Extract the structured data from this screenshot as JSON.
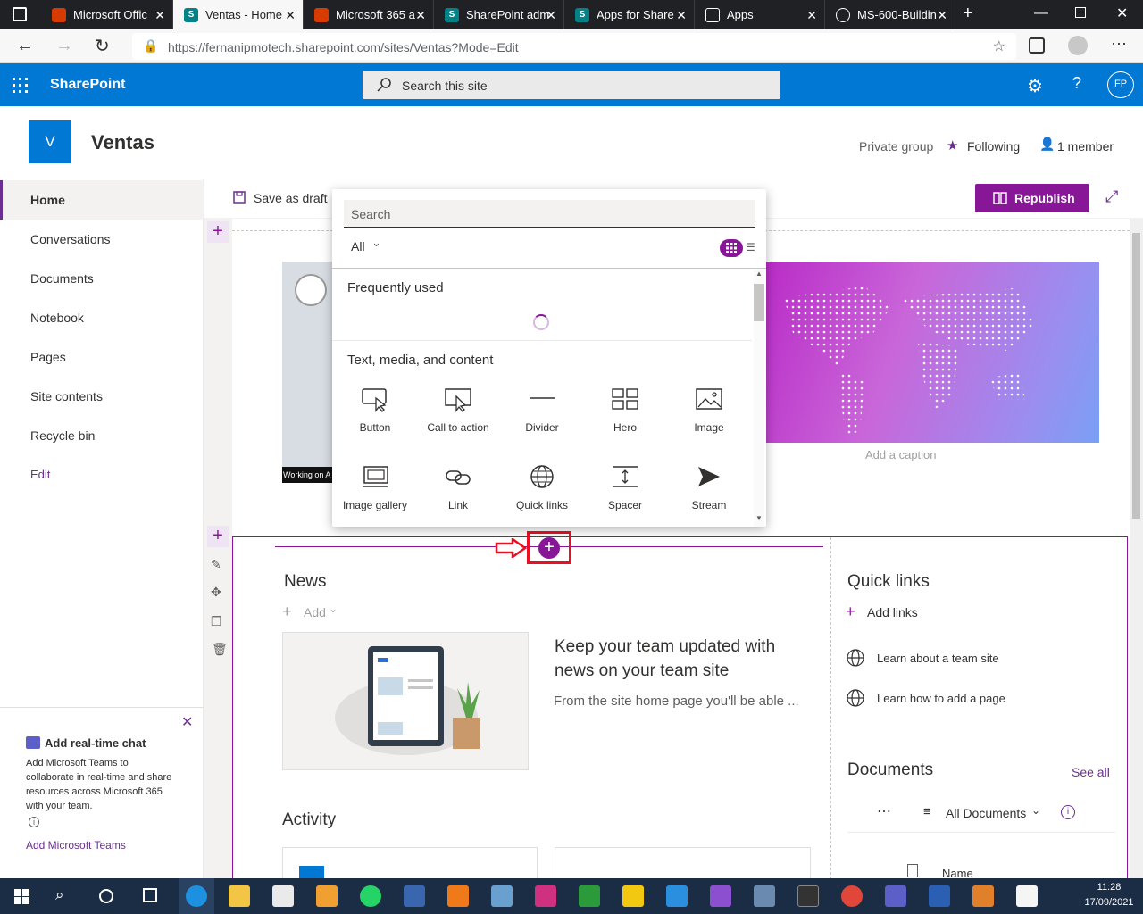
{
  "browser": {
    "tabs": [
      {
        "title": "Microsoft Offic",
        "active": false,
        "favicon_color": "#d83b01"
      },
      {
        "title": "Ventas - Home",
        "active": true,
        "favicon_color": "#038387"
      },
      {
        "title": "Microsoft 365 a",
        "active": false,
        "favicon_color": "#d83b01"
      },
      {
        "title": "SharePoint adm",
        "active": false,
        "favicon_color": "#038387"
      },
      {
        "title": "Apps for Share",
        "active": false,
        "favicon_color": "#038387"
      },
      {
        "title": "Apps",
        "active": false,
        "favicon_color": "#ffffff"
      },
      {
        "title": "MS-600-Buildin",
        "active": false,
        "favicon_color": "#ffffff"
      }
    ],
    "url": "https://fernanipmotech.sharepoint.com/sites/Ventas?Mode=Edit"
  },
  "suitebar": {
    "app_name": "SharePoint",
    "search_placeholder": "Search this site",
    "avatar_initials": "FP",
    "color": "#0078d4"
  },
  "site": {
    "logo_letter": "V",
    "title": "Ventas",
    "privacy": "Private group",
    "following": "Following",
    "members": "1 member",
    "accent": "#0078d4"
  },
  "leftnav": {
    "items": [
      "Home",
      "Conversations",
      "Documents",
      "Notebook",
      "Pages",
      "Site contents",
      "Recycle bin"
    ],
    "edit_label": "Edit"
  },
  "teams_promo": {
    "title": "Add real-time chat",
    "body": "Add Microsoft Teams to collaborate in real-time and share resources across Microsoft 365 with your team.",
    "link": "Add Microsoft Teams"
  },
  "commandbar": {
    "save_draft": "Save as draft",
    "republish": "Republish",
    "republish_color": "#881798"
  },
  "toolbox": {
    "search_placeholder": "Search",
    "filter": "All",
    "frequently_used": "Frequently used",
    "section_title": "Text, media, and content",
    "items": [
      {
        "label": "Button",
        "icon": "button-icon"
      },
      {
        "label": "Call to action",
        "icon": "call-to-action-icon"
      },
      {
        "label": "Divider",
        "icon": "divider-icon"
      },
      {
        "label": "Hero",
        "icon": "hero-icon"
      },
      {
        "label": "Image",
        "icon": "image-icon"
      },
      {
        "label": "Image gallery",
        "icon": "image-gallery-icon"
      },
      {
        "label": "Link",
        "icon": "link-icon"
      },
      {
        "label": "Quick links",
        "icon": "globe-icon"
      },
      {
        "label": "Spacer",
        "icon": "spacer-icon"
      },
      {
        "label": "Stream",
        "icon": "stream-icon"
      }
    ]
  },
  "canvas": {
    "image_caption_left": "Working on A",
    "caption_placeholder": "Add a caption"
  },
  "news": {
    "title": "News",
    "add": "Add",
    "headline": "Keep your team updated with news on your team site",
    "teaser": "From the site home page you'll be able ..."
  },
  "activity": {
    "title": "Activity"
  },
  "quicklinks": {
    "title": "Quick links",
    "add": "Add links",
    "items": [
      "Learn about a team site",
      "Learn how to add a page"
    ]
  },
  "documents": {
    "title": "Documents",
    "see_all": "See all",
    "view": "All Documents",
    "column": "Name"
  },
  "taskbar": {
    "time": "11:28",
    "date": "17/09/2021"
  }
}
